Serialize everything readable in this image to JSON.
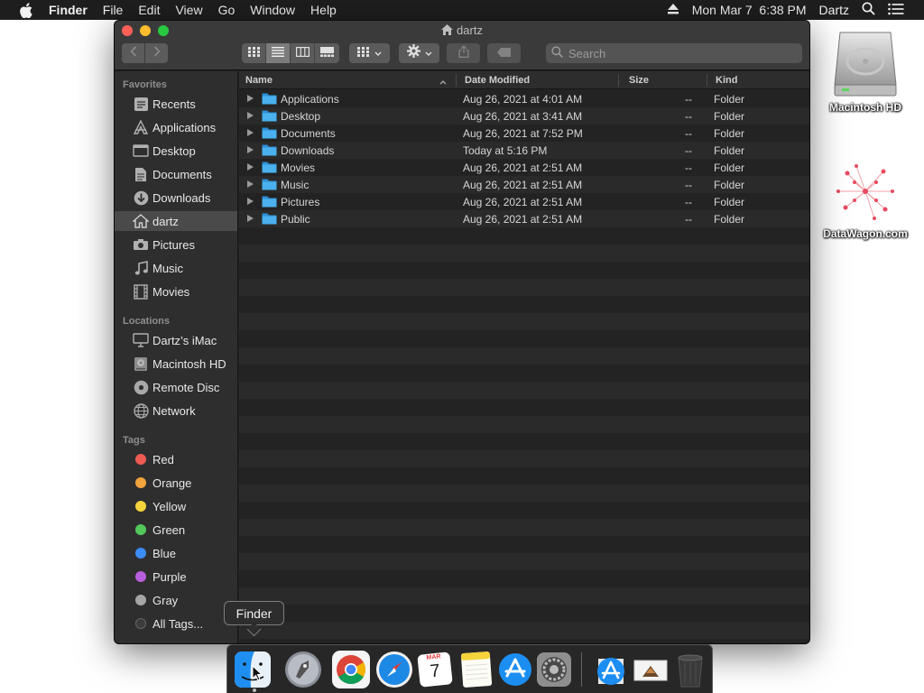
{
  "menubar": {
    "app_name": "Finder",
    "items": [
      "File",
      "Edit",
      "View",
      "Go",
      "Window",
      "Help"
    ],
    "clock": "Mon Mar 7  6:38 PM",
    "user": "Dartz"
  },
  "desktop": {
    "icons": [
      {
        "label": "Macintosh HD",
        "icon": "hard-drive-icon"
      },
      {
        "label": "DataWagon.com",
        "icon": "network-graph-icon"
      }
    ]
  },
  "window": {
    "title": "dartz",
    "search_placeholder": "Search",
    "view_mode": "list"
  },
  "sidebar": {
    "favorites_heading": "Favorites",
    "favorites": [
      {
        "label": "Recents",
        "icon": "clock-icon"
      },
      {
        "label": "Applications",
        "icon": "applications-icon"
      },
      {
        "label": "Desktop",
        "icon": "desktop-icon"
      },
      {
        "label": "Documents",
        "icon": "document-icon"
      },
      {
        "label": "Downloads",
        "icon": "download-icon"
      },
      {
        "label": "dartz",
        "icon": "home-icon",
        "selected": true
      },
      {
        "label": "Pictures",
        "icon": "camera-icon"
      },
      {
        "label": "Music",
        "icon": "music-note-icon"
      },
      {
        "label": "Movies",
        "icon": "film-icon"
      }
    ],
    "locations_heading": "Locations",
    "locations": [
      {
        "label": "Dartz’s iMac",
        "icon": "imac-icon"
      },
      {
        "label": "Macintosh HD",
        "icon": "drive-icon"
      },
      {
        "label": "Remote Disc",
        "icon": "disc-icon"
      },
      {
        "label": "Network",
        "icon": "globe-icon"
      }
    ],
    "tags_heading": "Tags",
    "tags": [
      {
        "label": "Red",
        "color": "#ee5b52"
      },
      {
        "label": "Orange",
        "color": "#f3a33b"
      },
      {
        "label": "Yellow",
        "color": "#f5d33c"
      },
      {
        "label": "Green",
        "color": "#52c85a"
      },
      {
        "label": "Blue",
        "color": "#3b8cf5"
      },
      {
        "label": "Purple",
        "color": "#b95edc"
      },
      {
        "label": "Gray",
        "color": "#a6a6a6"
      },
      {
        "label": "All Tags...",
        "color": ""
      }
    ]
  },
  "list": {
    "columns": [
      "Name",
      "Date Modified",
      "Size",
      "Kind"
    ],
    "rows": [
      {
        "name": "Applications",
        "date": "Aug 26, 2021 at 4:01 AM",
        "size": "--",
        "kind": "Folder"
      },
      {
        "name": "Desktop",
        "date": "Aug 26, 2021 at 3:41 AM",
        "size": "--",
        "kind": "Folder"
      },
      {
        "name": "Documents",
        "date": "Aug 26, 2021 at 7:52 PM",
        "size": "--",
        "kind": "Folder"
      },
      {
        "name": "Downloads",
        "date": "Today at 5:16 PM",
        "size": "--",
        "kind": "Folder"
      },
      {
        "name": "Movies",
        "date": "Aug 26, 2021 at 2:51 AM",
        "size": "--",
        "kind": "Folder"
      },
      {
        "name": "Music",
        "date": "Aug 26, 2021 at 2:51 AM",
        "size": "--",
        "kind": "Folder"
      },
      {
        "name": "Pictures",
        "date": "Aug 26, 2021 at 2:51 AM",
        "size": "--",
        "kind": "Folder"
      },
      {
        "name": "Public",
        "date": "Aug 26, 2021 at 2:51 AM",
        "size": "--",
        "kind": "Folder"
      }
    ]
  },
  "dock": {
    "tooltip": "Finder",
    "calendar_month": "MAR",
    "calendar_day": "7",
    "apps": [
      "finder-icon",
      "launchpad-icon",
      "chrome-icon",
      "safari-icon",
      "calendar-icon",
      "notes-icon",
      "app-store-icon",
      "system-preferences-icon",
      "app-store-download-icon",
      "image-preview-icon",
      "trash-icon"
    ]
  }
}
